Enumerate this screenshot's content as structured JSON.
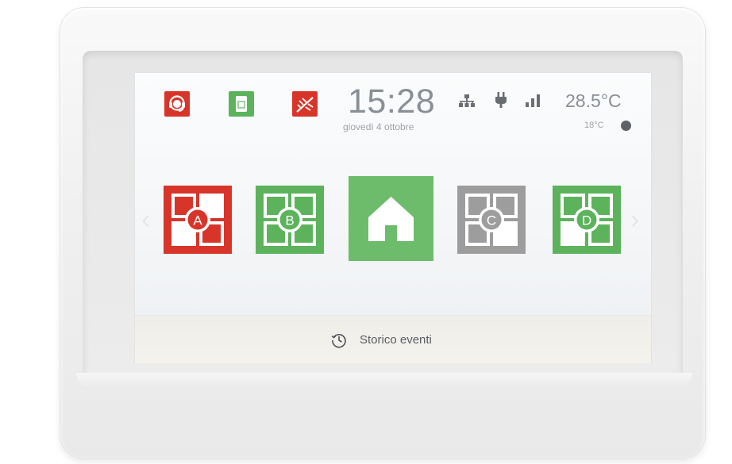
{
  "status": {
    "time": "15:28",
    "date": "giovedì 4 ottobre",
    "temperature_inside": "28.5°C",
    "temperature_outside": "18°C"
  },
  "partitions": [
    {
      "letter": "A",
      "state": "alarm",
      "color": "#d8352a"
    },
    {
      "letter": "B",
      "state": "armed",
      "color": "#5cb35c"
    },
    {
      "letter": "C",
      "state": "disarmed",
      "color": "#9d9d9d"
    },
    {
      "letter": "D",
      "state": "armed",
      "color": "#5cb35c"
    }
  ],
  "home": {
    "color": "#6cbc6c"
  },
  "footer": {
    "history_label": "Storico eventi"
  },
  "icons": {
    "operator": "operator-headset-icon",
    "sim": "sim-card-icon",
    "tamper": "tamper-icon",
    "network": "network-icon",
    "power": "power-plug-icon",
    "signal": "signal-strength-icon",
    "weather": "weather-icon",
    "history": "clock-icon"
  },
  "colors": {
    "alarm_red": "#d8352a",
    "ok_green": "#5cb35c",
    "inactive_gray": "#9d9d9d",
    "text_gray": "#8a8f96"
  }
}
